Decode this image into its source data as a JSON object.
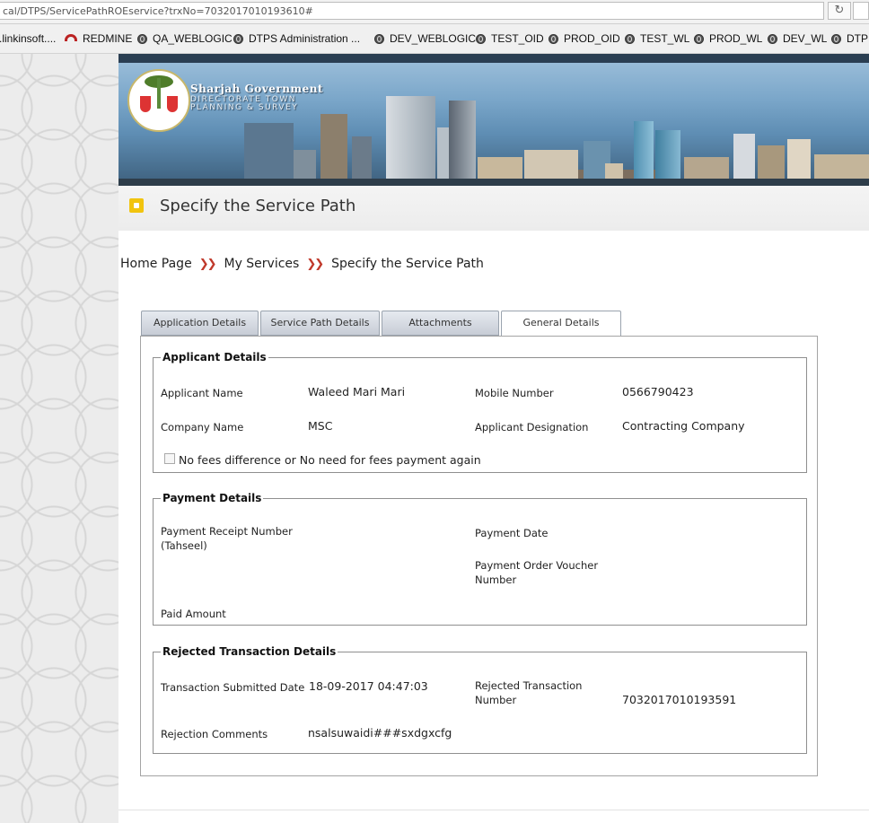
{
  "browser": {
    "url": "cal/DTPS/ServicePathROEservice?trxNo=7032017010193610#",
    "bookmarks": [
      ".linkinsoft....",
      "REDMINE",
      "QA_WEBLOGIC",
      "DTPS Administration ...",
      "DEV_WEBLOGIC",
      "TEST_OID",
      "PROD_OID",
      "TEST_WL",
      "PROD_WL",
      "DEV_WL",
      "DTP"
    ]
  },
  "header": {
    "org_title": "Sharjah Government",
    "org_sub1": "DIRECTORATE TOWN",
    "org_sub2": "PLANNING & SURVEY"
  },
  "page": {
    "title": "Specify the Service Path"
  },
  "breadcrumb": {
    "items": [
      "Home Page",
      "My Services",
      "Specify the Service Path"
    ]
  },
  "tabs": [
    {
      "label": "Application Details",
      "active": false
    },
    {
      "label": "Service Path Details",
      "active": false
    },
    {
      "label": "Attachments",
      "active": false
    },
    {
      "label": "General Details",
      "active": true
    }
  ],
  "applicant": {
    "legend": "Applicant Details",
    "name_label": "Applicant Name",
    "name_value": "Waleed Mari Mari",
    "mobile_label": "Mobile Number",
    "mobile_value": "0566790423",
    "company_label": "Company Name",
    "company_value": "MSC",
    "designation_label": "Applicant Designation",
    "designation_value": "Contracting Company",
    "checkbox_label": "No fees difference or No need for fees payment again"
  },
  "payment": {
    "legend": "Payment Details",
    "receipt_label_1": "Payment Receipt Number",
    "receipt_label_2": "(Tahseel)",
    "date_label": "Payment Date",
    "voucher_label_1": "Payment Order Voucher",
    "voucher_label_2": "Number",
    "paid_label": "Paid Amount"
  },
  "rejected": {
    "legend": "Rejected Transaction Details",
    "submitted_label": "Transaction Submitted Date",
    "submitted_value": "18-09-2017 04:47:03",
    "number_label_1": "Rejected Transaction",
    "number_label_2": "Number",
    "number_value": "7032017010193591",
    "comments_label": "Rejection Comments",
    "comments_value": "nsalsuwaidi###sxdgxcfg"
  },
  "colors": {
    "breadcrumb_separator": "#c0392b",
    "banner_sky": "#7aa6c9",
    "title_icon": "#f1c40f"
  }
}
